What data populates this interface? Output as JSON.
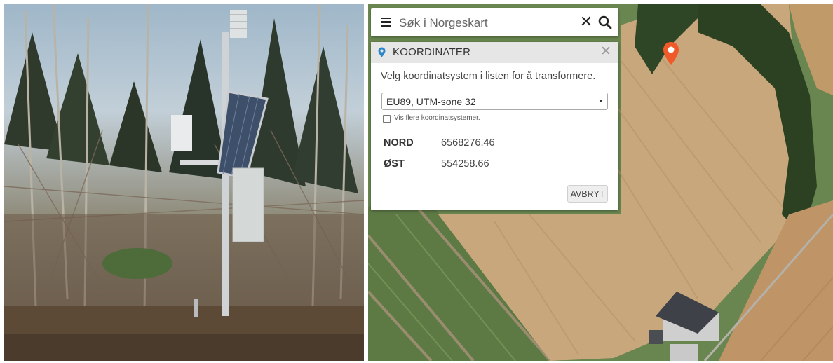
{
  "search": {
    "placeholder": "Søk i Norgeskart",
    "clear_icon": "close-icon",
    "search_icon": "search-icon",
    "menu_icon": "hamburger-menu-icon"
  },
  "panel": {
    "title": "KOORDINATER",
    "header_icon": "map-marker-icon",
    "close_icon": "close-icon",
    "instruction": "Velg koordinatsystem i listen for å transformere.",
    "coordinate_system": "EU89, UTM-sone 32",
    "show_more_label": "Vis flere koordinatsystemer.",
    "show_more_checked": false,
    "north_label": "NORD",
    "north_value": "6568276.46",
    "east_label": "ØST",
    "east_value": "554258.66",
    "cancel_label": "AVBRYT"
  },
  "map": {
    "marker_icon": "map-pin-icon",
    "marker_color": "#ef5a28"
  },
  "colors": {
    "panel_header_bg": "#e6e6e6",
    "accent": "#2a86c9"
  }
}
